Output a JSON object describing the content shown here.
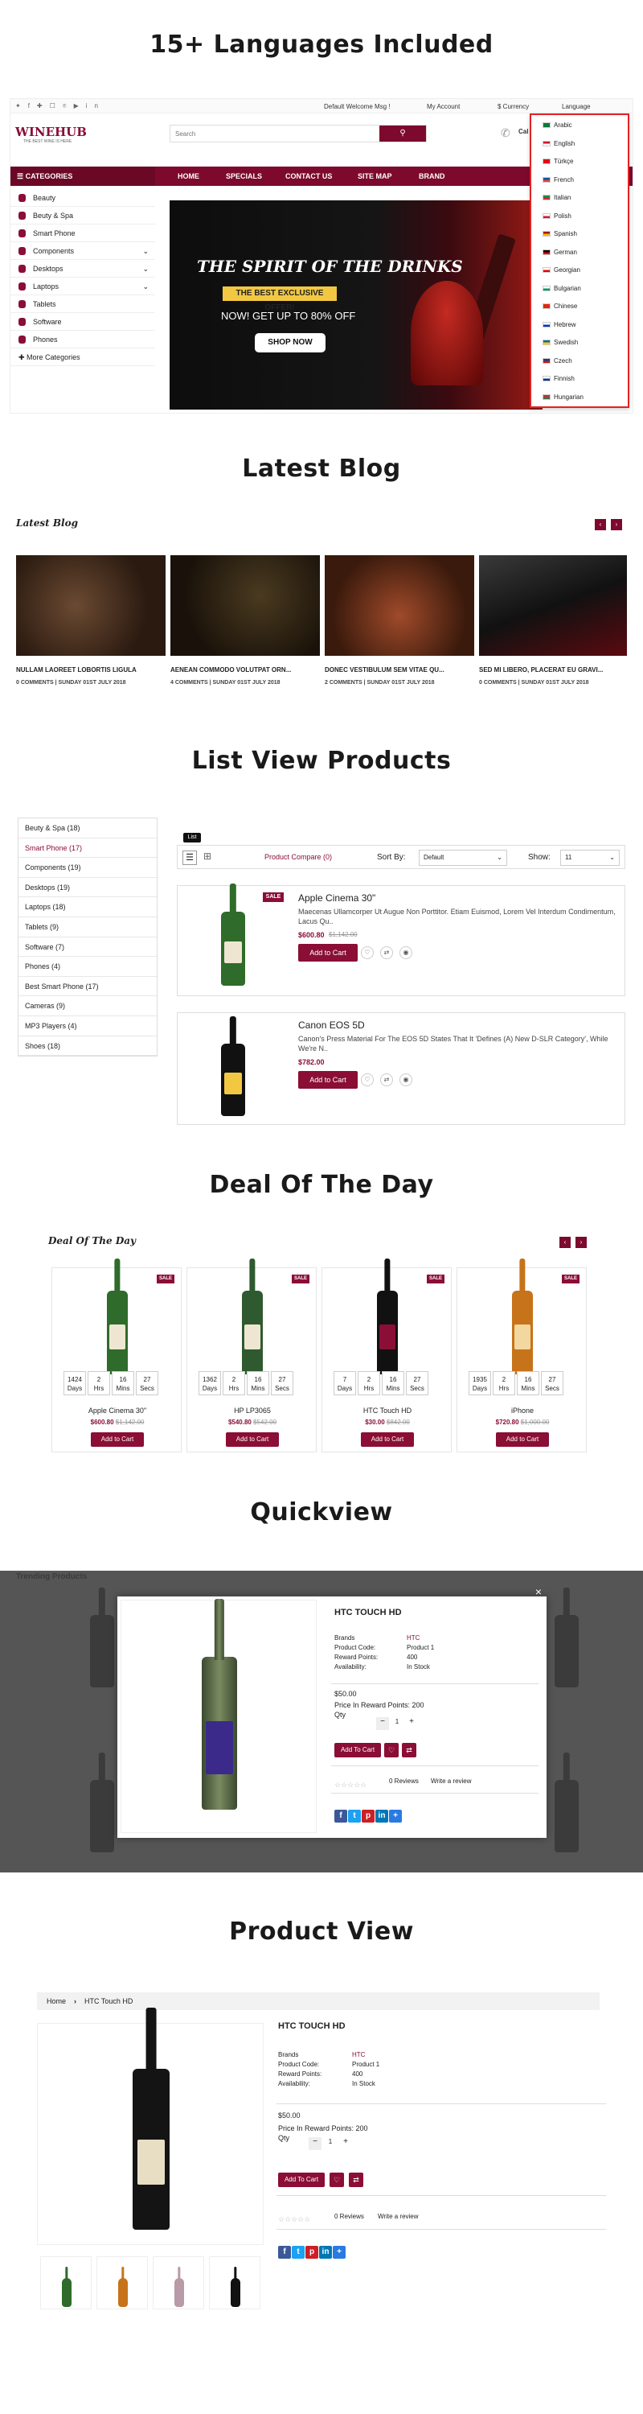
{
  "sections": {
    "languages": "15+ Languages Included",
    "blog": "Latest Blog",
    "list": "List View Products",
    "deal": "Deal Of The Day",
    "quickview": "Quickview",
    "product": "Product View"
  },
  "topbar": {
    "welcome": "Default Welcome Msg !",
    "account": "My Account",
    "currency": "$ Currency",
    "language": "Language"
  },
  "header": {
    "logo": "WINEHUB",
    "tagline": "THE BEST WINE IS HERE",
    "search_placeholder": "Search",
    "call": "Cal"
  },
  "nav": {
    "categories": "CATEGORIES",
    "items": [
      "HOME",
      "SPECIALS",
      "CONTACT US",
      "SITE MAP",
      "BRAND"
    ]
  },
  "sidebar": {
    "items": [
      "Beauty",
      "Beuty & Spa",
      "Smart Phone",
      "Components",
      "Desktops",
      "Laptops",
      "Tablets",
      "Software",
      "Phones"
    ],
    "more": "More Categories"
  },
  "banner": {
    "title": "THE SPIRIT OF THE DRINKS",
    "badge": "THE BEST EXCLUSIVE OFFER!",
    "offer": "NOW! GET UP TO 80% OFF",
    "cta": "SHOP NOW"
  },
  "languages": [
    "Arabic",
    "English",
    "Türkçe",
    "French",
    "Italian",
    "Polish",
    "Spanish",
    "German",
    "Georgian",
    "Bulgarian",
    "Chinese",
    "Hebrew",
    "Swedish",
    "Czech",
    "Finnish",
    "Hungarian"
  ],
  "blog": {
    "heading": "Latest Blog",
    "posts": [
      {
        "title": "NULLAM LAOREET LOBORTIS LIGULA",
        "meta": "0 COMMENTS | SUNDAY 01ST JULY 2018"
      },
      {
        "title": "AENEAN COMMODO VOLUTPAT ORN...",
        "meta": "4 COMMENTS | SUNDAY 01ST JULY 2018"
      },
      {
        "title": "DONEC VESTIBULUM SEM VITAE QU...",
        "meta": "2 COMMENTS | SUNDAY 01ST JULY 2018"
      },
      {
        "title": "SED MI LIBERO, PLACERAT EU GRAVI...",
        "meta": "0 COMMENTS | SUNDAY 01ST JULY 2018"
      }
    ]
  },
  "listview": {
    "categories": [
      "Beuty & Spa (18)",
      "Smart Phone (17)",
      "Components (19)",
      "Desktops (19)",
      "Laptops (18)",
      "Tablets (9)",
      "Software (7)",
      "Phones (4)",
      "Best Smart Phone (17)",
      "Cameras (9)",
      "MP3 Players (4)",
      "Shoes (18)"
    ],
    "tooltip": "List",
    "compare": "Product Compare (0)",
    "sort_label": "Sort By:",
    "sort_value": "Default",
    "show_label": "Show:",
    "show_value": "11",
    "products": [
      {
        "name": "Apple Cinema 30\"",
        "desc": "Maecenas Ullamcorper Ut Augue Non Porttitor. Etiam Euismod, Lorem Vel Interdum Condimentum, Lacus Qu..",
        "price": "$600.80",
        "old": "$1,142.00",
        "sale": "SALE"
      },
      {
        "name": "Canon EOS 5D",
        "desc": "Canon's Press Material For The EOS 5D States That It 'Defines (A) New D-SLR Category', While We're N..",
        "price": "$782.00",
        "old": "",
        "sale": ""
      }
    ],
    "cart": "Add to Cart"
  },
  "deal": {
    "heading": "Deal Of The Day",
    "items": [
      {
        "name": "Apple Cinema 30\"",
        "price": "$600.80",
        "old": "$1,142.00",
        "d": "1424",
        "h": "2",
        "m": "16",
        "s": "27"
      },
      {
        "name": "HP LP3065",
        "price": "$540.80",
        "old": "$542.00",
        "d": "1362",
        "h": "2",
        "m": "16",
        "s": "27"
      },
      {
        "name": "HTC Touch HD",
        "price": "$30.00",
        "old": "$842.00",
        "d": "7",
        "h": "2",
        "m": "16",
        "s": "27"
      },
      {
        "name": "iPhone",
        "price": "$720.80",
        "old": "$1,000.00",
        "d": "1935",
        "h": "2",
        "m": "16",
        "s": "27"
      }
    ],
    "units": [
      "Days",
      "Hrs",
      "Mins",
      "Secs"
    ],
    "sale": "SALE",
    "cart": "Add to Cart"
  },
  "quick": {
    "bg_title": "Trending Products",
    "title": "HTC TOUCH HD",
    "brands_l": "Brands",
    "brands_v": "HTC",
    "code_l": "Product Code:",
    "code_v": "Product 1",
    "reward_l": "Reward Points:",
    "reward_v": "400",
    "avail_l": "Availability:",
    "avail_v": "In Stock",
    "price": "$50.00",
    "reward_price": "Price In Reward Points: 200",
    "qty": "Qty",
    "qty_v": "1",
    "cart": "Add To Cart",
    "reviews": "0 Reviews",
    "write": "Write a review",
    "close": "×"
  },
  "productview": {
    "crumb_home": "Home",
    "crumb_item": "HTC Touch HD",
    "title": "HTC TOUCH HD",
    "brands_l": "Brands",
    "brands_v": "HTC",
    "code_l": "Product Code:",
    "code_v": "Product 1",
    "reward_l": "Reward Points:",
    "reward_v": "400",
    "avail_l": "Availability:",
    "avail_v": "In Stock",
    "price": "$50.00",
    "reward_price": "Price In Reward Points: 200",
    "qty": "Qty",
    "qty_v": "1",
    "cart": "Add To Cart",
    "reviews": "0 Reviews",
    "write": "Write a review"
  },
  "colors": {
    "brand": "#8a0e35",
    "accent": "#e32222"
  }
}
